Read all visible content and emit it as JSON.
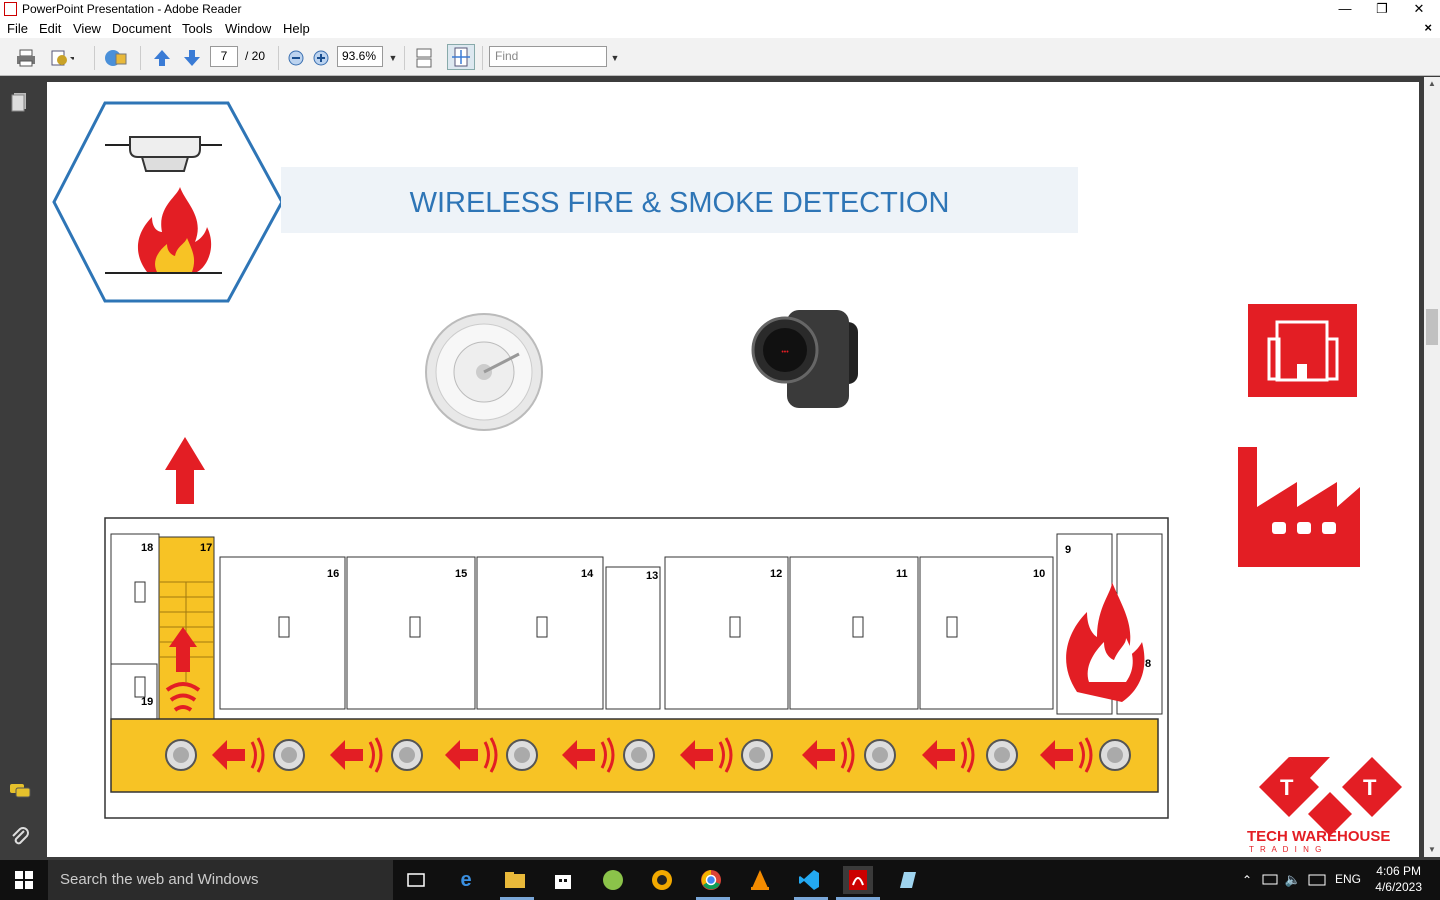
{
  "window": {
    "title": "PowerPoint Presentation - Adobe Reader",
    "minimize": "—",
    "restore": "❐",
    "close": "✕"
  },
  "menu": {
    "items": [
      "File",
      "Edit",
      "View",
      "Document",
      "Tools",
      "Window",
      "Help"
    ],
    "close_doc": "×"
  },
  "toolbar": {
    "page_current": "7",
    "page_total": "/ 20",
    "zoom": "93.6%",
    "find_placeholder": "Find"
  },
  "slide": {
    "title": "WIRELESS FIRE & SMOKE DETECTION",
    "rooms": [
      "18",
      "17",
      "16",
      "15",
      "14",
      "13",
      "12",
      "11",
      "10",
      "9",
      "8",
      "19"
    ],
    "brand_line1": "TECH WAREHOUSE",
    "brand_line2": "T R A D I N G",
    "brand_letters": [
      "T",
      "T"
    ]
  },
  "taskbar": {
    "search_placeholder": "Search the web and Windows",
    "language": "ENG",
    "time": "4:06 PM",
    "date": "4/6/2023"
  },
  "colors": {
    "accent_blue": "#2e75b6",
    "alarm_red": "#e31e24",
    "corridor_yellow": "#f7c325"
  }
}
